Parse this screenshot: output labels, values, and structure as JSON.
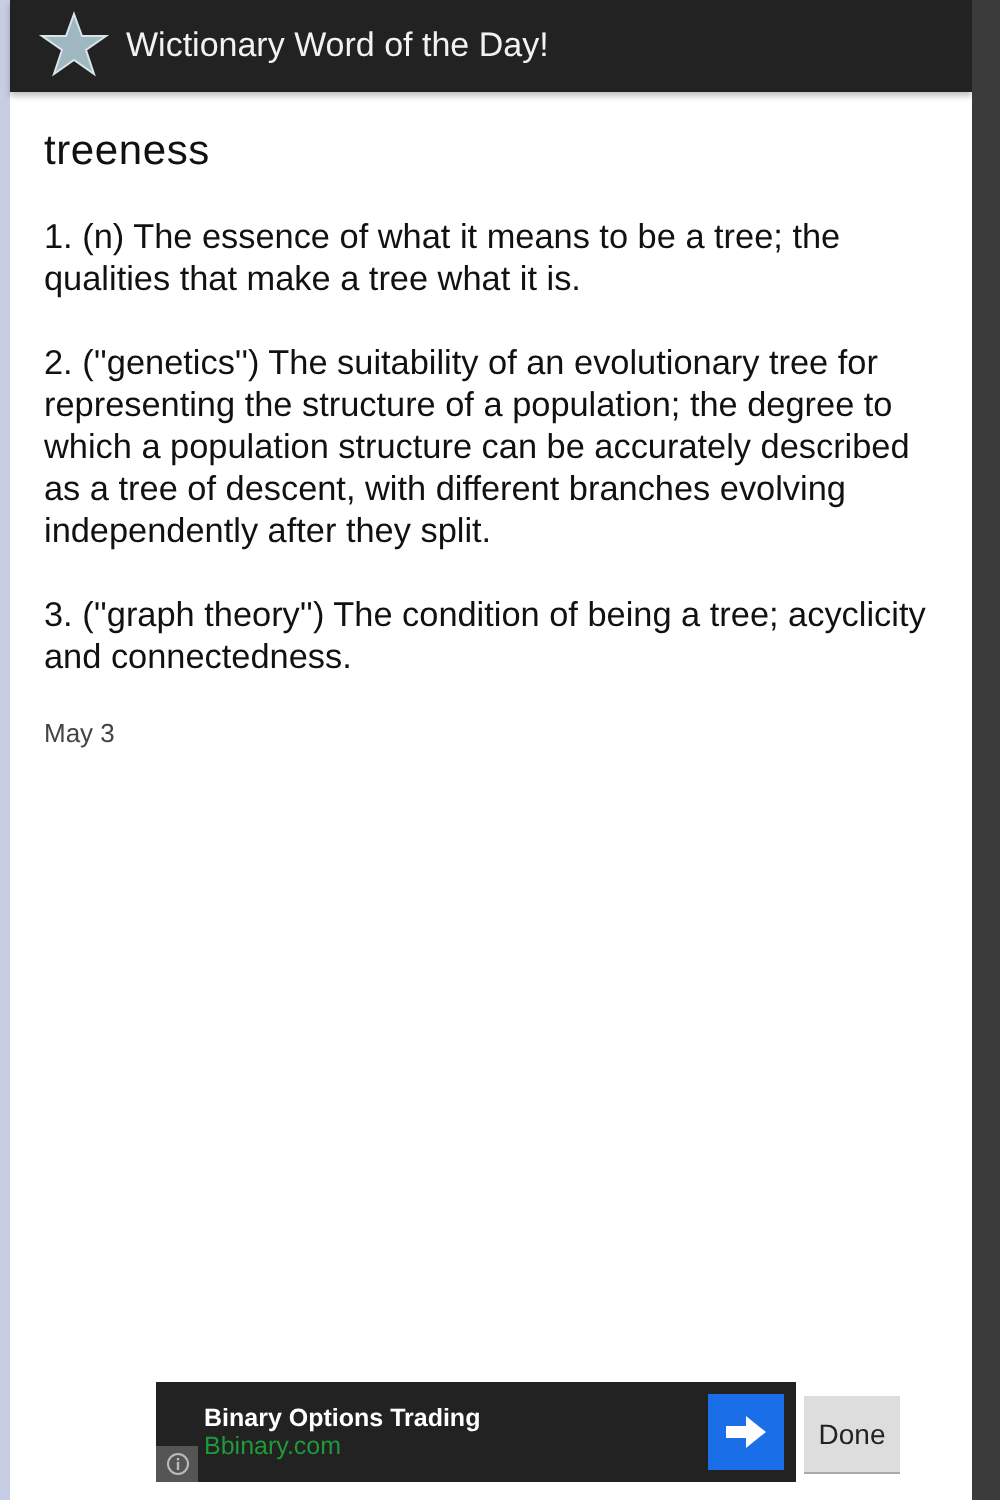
{
  "app_bar": {
    "title": "Wictionary Word of the Day!"
  },
  "word": "treeness",
  "definitions": [
    "1. (n) The essence of what it means to be a tree; the qualities that make a tree what it is.",
    "2.  (''genetics'') The suitability of an evolutionary tree for representing the structure of a population; the degree to which a population structure can be accurately described as a tree of descent, with different branches evolving independently after they split.",
    "3.  (''graph theory'') The condition of being a tree; acyclicity and connectedness."
  ],
  "date": "May 3",
  "ad": {
    "title": "Binary Options Trading",
    "url": "Bbinary.com"
  },
  "done_button": "Done"
}
